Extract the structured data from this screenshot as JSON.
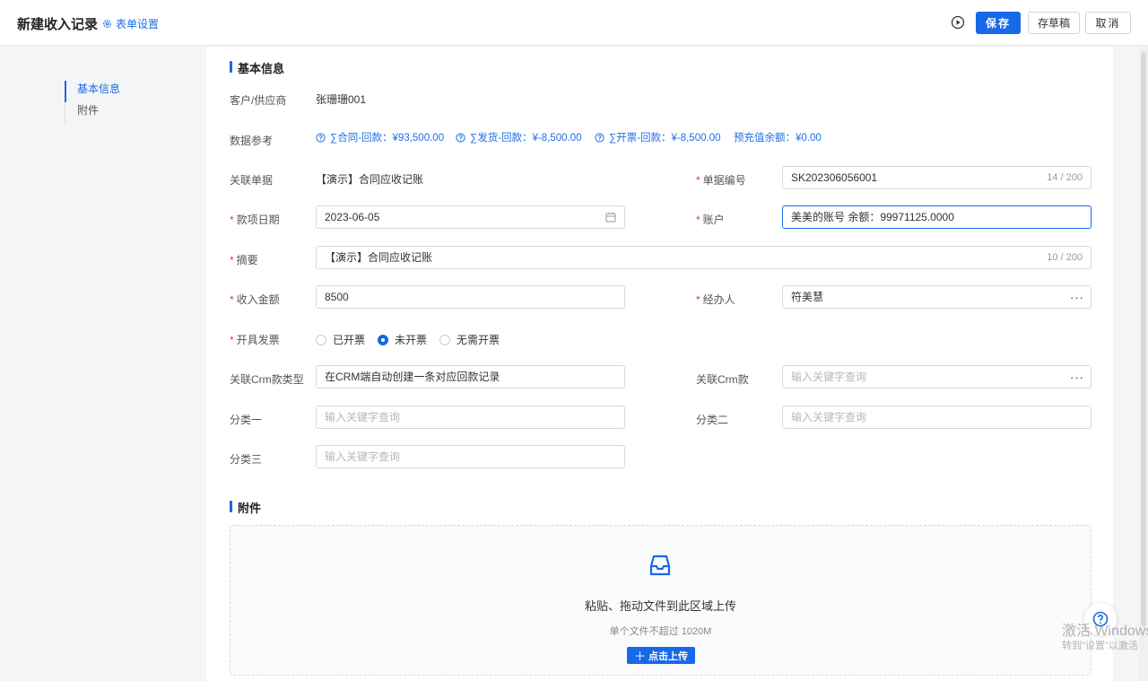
{
  "header": {
    "title": "新建收入记录",
    "form_settings": "表单设置",
    "save": "保存",
    "draft": "存草稿",
    "cancel": "取消"
  },
  "nav": {
    "items": [
      {
        "label": "基本信息",
        "active": true
      },
      {
        "label": "附件",
        "active": false
      }
    ]
  },
  "basic": {
    "section_title": "基本信息",
    "customer_label": "客户/供应商",
    "customer_value": "张珊珊001",
    "data_ref_label": "数据参考",
    "refs": [
      "∑合同-回款：¥93,500.00",
      "∑发货-回款：¥-8,500.00",
      "∑开票-回款：¥-8,500.00",
      "预充值余额：¥0.00"
    ],
    "related_doc_label": "关联单据",
    "related_doc_value": "【演示】合同应收记账",
    "doc_no_label": "单据编号",
    "doc_no_value": "SK202306056001",
    "doc_no_counter": "14 / 200",
    "date_label": "款项日期",
    "date_value": "2023-06-05",
    "account_label": "账户",
    "account_value": "美美的账号 余额：99971125.0000",
    "summary_label": "摘要",
    "summary_value": "【演示】合同应收记账",
    "summary_counter": "10 / 200",
    "amount_label": "收入金额",
    "amount_value": "8500",
    "handler_label": "经办人",
    "handler_value": "符美慧",
    "invoice_label": "开具发票",
    "invoice_options": [
      "已开票",
      "未开票",
      "无需开票"
    ],
    "invoice_selected": "未开票",
    "crm_type_label": "关联Crm款类型",
    "crm_type_value": "在CRM端自动创建一条对应回款记录",
    "crm_label": "关联Crm款",
    "crm_placeholder": "输入关键字查询",
    "cat1_label": "分类一",
    "cat1_placeholder": "输入关键字查询",
    "cat2_label": "分类二",
    "cat2_placeholder": "输入关键字查询",
    "cat3_label": "分类三",
    "cat3_placeholder": "输入关键字查询"
  },
  "attachment": {
    "section_title": "附件",
    "drop_text": "粘贴、拖动文件到此区域上传",
    "limit_text": "单个文件不超过 1020M",
    "upload_button": "点击上传"
  },
  "watermark": {
    "line1": "激活 Windows",
    "line2": "转到\"设置\"以激活"
  },
  "colors": {
    "accent": "#1769e8",
    "required": "#e03a3a"
  }
}
